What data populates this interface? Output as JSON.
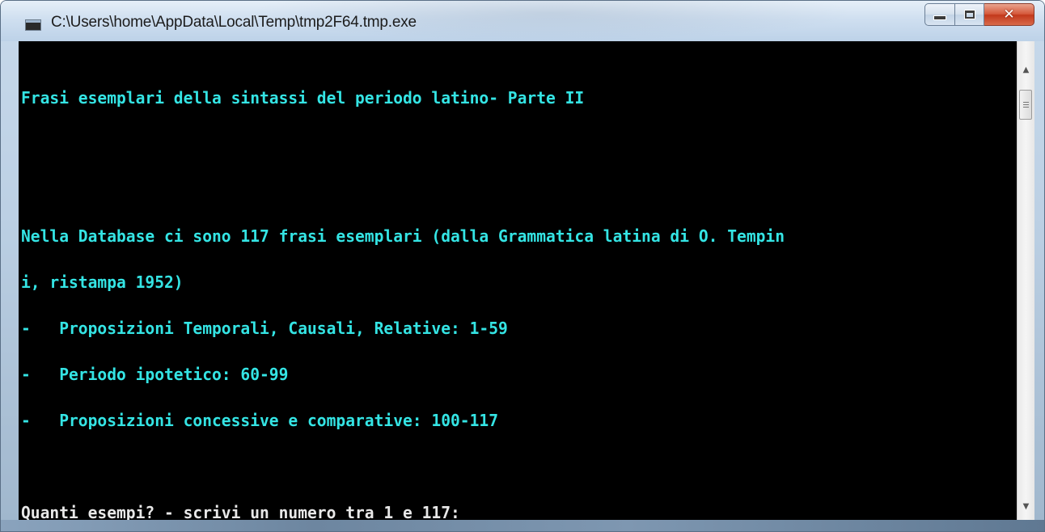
{
  "window": {
    "title": "C:\\Users\\home\\AppData\\Local\\Temp\\tmp2F64.tmp.exe",
    "icon": "console-app-icon",
    "controls": {
      "minimize": "minimize-icon",
      "maximize": "maximize-icon",
      "close": "close-icon"
    }
  },
  "console": {
    "background": "#000000",
    "text_color_cyan": "#34e4e4",
    "text_color_white": "#e8e8e8",
    "lines": [
      "Frasi esemplari della sintassi del periodo latino- Parte II",
      "",
      "",
      "Nella Database ci sono 117 frasi esemplari (dalla Grammatica latina di O. Tempin",
      "i, ristampa 1952)",
      "-   Proposizioni Temporali, Causali, Relative: 1-59",
      "-   Periodo ipotetico: 60-99",
      "-   Proposizioni concessive e comparative: 100-117",
      "",
      "Quanti esempi? - scrivi un numero tra 1 e 117:"
    ]
  },
  "scrollbar": {
    "up_arrow": "scroll-up-arrow-icon",
    "down_arrow": "scroll-down-arrow-icon"
  }
}
